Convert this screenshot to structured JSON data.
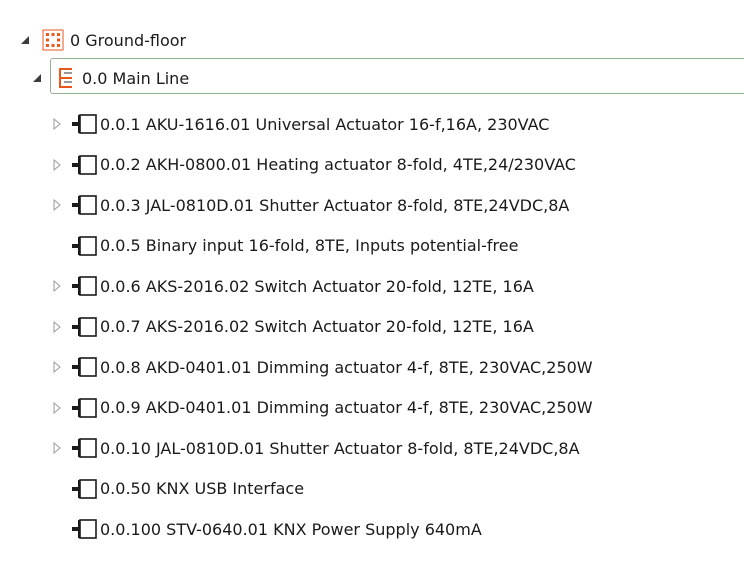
{
  "top_text": "",
  "tree": {
    "root": {
      "label": "0 Ground-floor",
      "icon": "floor-grid-icon",
      "expanded": true
    },
    "line": {
      "label": "0.0 Main Line",
      "icon": "line-tree-icon",
      "expanded": true,
      "selected": true
    },
    "devices": [
      {
        "label": "0.0.1  AKU-1616.01 Universal Actuator 16-f,16A, 230VAC",
        "expandable": true
      },
      {
        "label": "0.0.2  AKH-0800.01 Heating actuator 8-fold, 4TE,24/230VAC",
        "expandable": true
      },
      {
        "label": "0.0.3  JAL-0810D.01 Shutter Actuator 8-fold, 8TE,24VDC,8A",
        "expandable": true
      },
      {
        "label": "0.0.5  Binary input 16-fold, 8TE, Inputs potential-free",
        "expandable": false
      },
      {
        "label": "0.0.6  AKS-2016.02 Switch Actuator 20-fold, 12TE, 16A",
        "expandable": true
      },
      {
        "label": "0.0.7  AKS-2016.02 Switch Actuator 20-fold, 12TE, 16A",
        "expandable": true
      },
      {
        "label": "0.0.8  AKD-0401.01 Dimming actuator 4-f, 8TE, 230VAC,250W",
        "expandable": true
      },
      {
        "label": "0.0.9  AKD-0401.01 Dimming actuator 4-f, 8TE, 230VAC,250W",
        "expandable": true
      },
      {
        "label": "0.0.10  JAL-0810D.01 Shutter Actuator 8-fold, 8TE,24VDC,8A",
        "expandable": true
      },
      {
        "label": "0.0.50  KNX USB Interface",
        "expandable": false
      },
      {
        "label": "0.0.100  STV-0640.01 KNX Power Supply 640mA",
        "expandable": false
      }
    ]
  },
  "colors": {
    "accent_orange": "#e8581c",
    "selection_border": "#8fb38f",
    "arrow_gray": "#9a9a9a",
    "arrow_dark": "#3c3c3c"
  }
}
